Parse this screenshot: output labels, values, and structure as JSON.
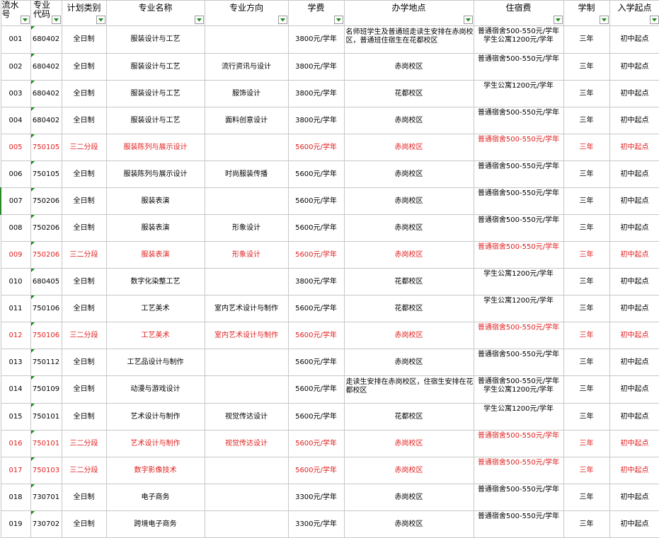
{
  "columns": [
    {
      "key": "no",
      "label": "流水号"
    },
    {
      "key": "code",
      "label": "专业代码"
    },
    {
      "key": "type",
      "label": "计划类别"
    },
    {
      "key": "major",
      "label": "专业名称"
    },
    {
      "key": "direction",
      "label": "专业方向"
    },
    {
      "key": "fee",
      "label": "学费"
    },
    {
      "key": "location",
      "label": "办学地点"
    },
    {
      "key": "dorm",
      "label": "住宿费"
    },
    {
      "key": "duration",
      "label": "学制"
    },
    {
      "key": "entry",
      "label": "入学起点"
    }
  ],
  "rows": [
    {
      "no": "001",
      "code": "680402",
      "type": "全日制",
      "major": "服装设计与工艺",
      "direction": "",
      "fee": "3800元/学年",
      "location": "名师班学生及普通班走读生安排在赤岗校区，普通班住宿生在花都校区",
      "dorm": "普通宿舍500-550元/学年  学生公寓1200元/学年",
      "duration": "三年",
      "entry": "初中起点",
      "highlight": false
    },
    {
      "no": "002",
      "code": "680402",
      "type": "全日制",
      "major": "服装设计与工艺",
      "direction": "流行资讯与设计",
      "fee": "3800元/学年",
      "location": "赤岗校区",
      "dorm": "普通宿舍500-550元/学年",
      "duration": "三年",
      "entry": "初中起点",
      "highlight": false
    },
    {
      "no": "003",
      "code": "680402",
      "type": "全日制",
      "major": "服装设计与工艺",
      "direction": "服饰设计",
      "fee": "3800元/学年",
      "location": "花都校区",
      "dorm": "学生公寓1200元/学年",
      "duration": "三年",
      "entry": "初中起点",
      "highlight": false
    },
    {
      "no": "004",
      "code": "680402",
      "type": "全日制",
      "major": "服装设计与工艺",
      "direction": "面料创意设计",
      "fee": "3800元/学年",
      "location": "赤岗校区",
      "dorm": "普通宿舍500-550元/学年",
      "duration": "三年",
      "entry": "初中起点",
      "highlight": false
    },
    {
      "no": "005",
      "code": "750105",
      "type": "三二分段",
      "major": "服装陈列与展示设计",
      "direction": "",
      "fee": "5600元/学年",
      "location": "赤岗校区",
      "dorm": "普通宿舍500-550元/学年",
      "duration": "三年",
      "entry": "初中起点",
      "highlight": true
    },
    {
      "no": "006",
      "code": "750105",
      "type": "全日制",
      "major": "服装陈列与展示设计",
      "direction": "时尚服装传播",
      "fee": "5600元/学年",
      "location": "赤岗校区",
      "dorm": "普通宿舍500-550元/学年",
      "duration": "三年",
      "entry": "初中起点",
      "highlight": false
    },
    {
      "no": "007",
      "code": "750206",
      "type": "全日制",
      "major": "服装表演",
      "direction": "",
      "fee": "5600元/学年",
      "location": "赤岗校区",
      "dorm": "普通宿舍500-550元/学年",
      "duration": "三年",
      "entry": "初中起点",
      "highlight": false
    },
    {
      "no": "008",
      "code": "750206",
      "type": "全日制",
      "major": "服装表演",
      "direction": "形象设计",
      "fee": "5600元/学年",
      "location": "赤岗校区",
      "dorm": "普通宿舍500-550元/学年",
      "duration": "三年",
      "entry": "初中起点",
      "highlight": false
    },
    {
      "no": "009",
      "code": "750206",
      "type": "三二分段",
      "major": "服装表演",
      "direction": "形象设计",
      "fee": "5600元/学年",
      "location": "赤岗校区",
      "dorm": "普通宿舍500-550元/学年",
      "duration": "三年",
      "entry": "初中起点",
      "highlight": true
    },
    {
      "no": "010",
      "code": "680405",
      "type": "全日制",
      "major": "数字化染整工艺",
      "direction": "",
      "fee": "3800元/学年",
      "location": "花都校区",
      "dorm": "学生公寓1200元/学年",
      "duration": "三年",
      "entry": "初中起点",
      "highlight": false
    },
    {
      "no": "011",
      "code": "750106",
      "type": "全日制",
      "major": "工艺美术",
      "direction": "室内艺术设计与制作",
      "fee": "5600元/学年",
      "location": "花都校区",
      "dorm": "学生公寓1200元/学年",
      "duration": "三年",
      "entry": "初中起点",
      "highlight": false
    },
    {
      "no": "012",
      "code": "750106",
      "type": "三二分段",
      "major": "工艺美术",
      "direction": "室内艺术设计与制作",
      "fee": "5600元/学年",
      "location": "赤岗校区",
      "dorm": "普通宿舍500-550元/学年",
      "duration": "三年",
      "entry": "初中起点",
      "highlight": true
    },
    {
      "no": "013",
      "code": "750112",
      "type": "全日制",
      "major": "工艺品设计与制作",
      "direction": "",
      "fee": "5600元/学年",
      "location": "赤岗校区",
      "dorm": "普通宿舍500-550元/学年",
      "duration": "三年",
      "entry": "初中起点",
      "highlight": false
    },
    {
      "no": "014",
      "code": "750109",
      "type": "全日制",
      "major": "动漫与游戏设计",
      "direction": "",
      "fee": "5600元/学年",
      "location": "走读生安排在赤岗校区，住宿生安排在花都校区",
      "dorm": "普通宿舍500-550元/学年  学生公寓1200元/学年",
      "duration": "三年",
      "entry": "初中起点",
      "highlight": false
    },
    {
      "no": "015",
      "code": "750101",
      "type": "全日制",
      "major": "艺术设计与制作",
      "direction": "视觉传达设计",
      "fee": "5600元/学年",
      "location": "花都校区",
      "dorm": "学生公寓1200元/学年",
      "duration": "三年",
      "entry": "初中起点",
      "highlight": false
    },
    {
      "no": "016",
      "code": "750101",
      "type": "三二分段",
      "major": "艺术设计与制作",
      "direction": "视觉传达设计",
      "fee": "5600元/学年",
      "location": "赤岗校区",
      "dorm": "普通宿舍500-550元/学年",
      "duration": "三年",
      "entry": "初中起点",
      "highlight": true
    },
    {
      "no": "017",
      "code": "750103",
      "type": "三二分段",
      "major": "数字影像技术",
      "direction": "",
      "fee": "5600元/学年",
      "location": "赤岗校区",
      "dorm": "普通宿舍500-550元/学年",
      "duration": "三年",
      "entry": "初中起点",
      "highlight": true
    },
    {
      "no": "018",
      "code": "730701",
      "type": "全日制",
      "major": "电子商务",
      "direction": "",
      "fee": "3300元/学年",
      "location": "赤岗校区",
      "dorm": "普通宿舍500-550元/学年",
      "duration": "三年",
      "entry": "初中起点",
      "highlight": false
    },
    {
      "no": "019",
      "code": "730702",
      "type": "全日制",
      "major": "跨境电子商务",
      "direction": "",
      "fee": "3300元/学年",
      "location": "赤岗校区",
      "dorm": "普通宿舍500-550元/学年",
      "duration": "三年",
      "entry": "初中起点",
      "highlight": false
    }
  ],
  "colors": {
    "highlight_text": "#e02020",
    "grid_line": "#c8c8c8",
    "comment_marker": "#1a8a1a",
    "filter_arrow": "#1a8a1a"
  },
  "icons": {
    "filter": "filter-dropdown-icon",
    "comment_marker": "comment-indicator-icon"
  }
}
